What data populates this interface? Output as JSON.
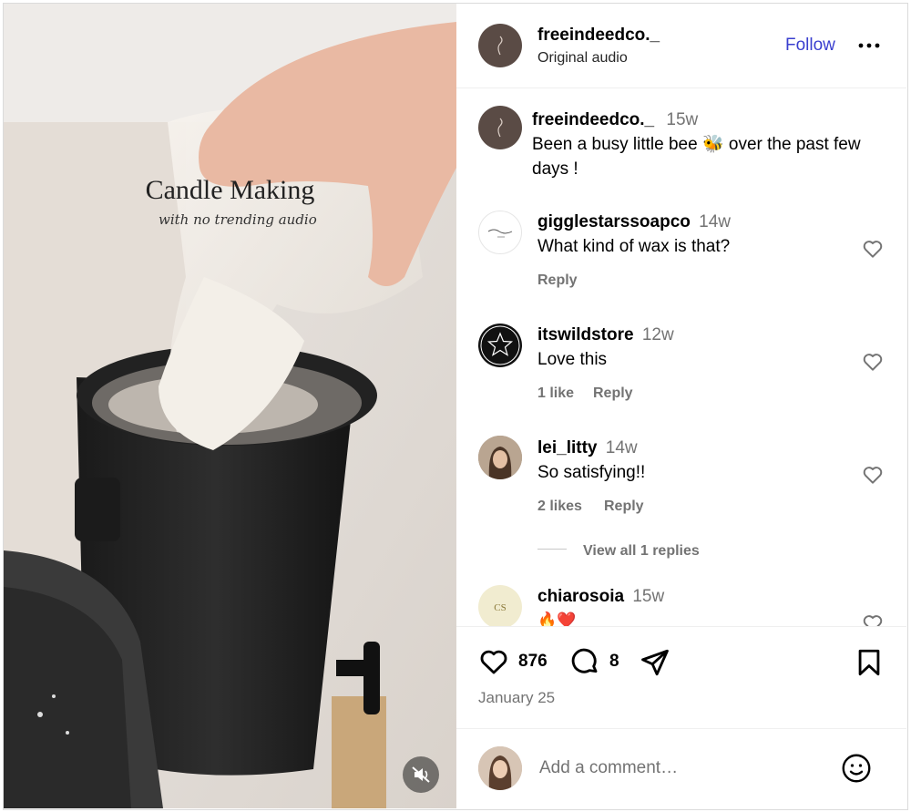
{
  "video": {
    "overlay_title": "Candle Making",
    "overlay_subtitle": "with no trending audio"
  },
  "header": {
    "username": "freeindeedco._",
    "subtitle": "Original audio",
    "follow_label": "Follow",
    "more_icon": "more-horizontal-icon"
  },
  "caption": {
    "username": "freeindeedco._",
    "time": "15w",
    "text": "Been a busy little bee 🐝 over the past few days !"
  },
  "comments": [
    {
      "username": "gigglestarssoapco",
      "time": "14w",
      "text": "What kind of wax is that?",
      "likes": "",
      "reply": "Reply"
    },
    {
      "username": "itswildstore",
      "time": "12w",
      "text": "Love this",
      "likes": "1 like",
      "reply": "Reply"
    },
    {
      "username": "lei_litty",
      "time": "14w",
      "text": "So satisfying!!",
      "likes": "2 likes",
      "reply": "Reply",
      "view_replies": "View all 1 replies"
    },
    {
      "username": "chiarosoia",
      "time": "15w",
      "text": "🔥❤️"
    }
  ],
  "actions": {
    "like_count": "876",
    "comment_count": "8",
    "date": "January 25"
  },
  "composer": {
    "placeholder": "Add a comment…"
  },
  "colors": {
    "follow": "#3a3fcf",
    "muted": "#737373",
    "border": "#dbdbdb"
  }
}
